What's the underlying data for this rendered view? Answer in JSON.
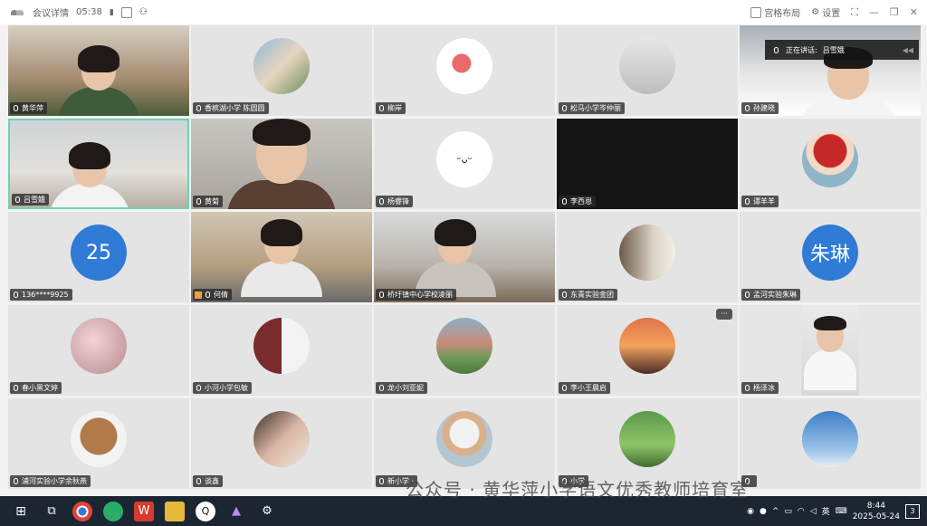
{
  "topbar": {
    "app_title": "会议详情",
    "timer": "05:38",
    "layout_label": "宫格布局",
    "settings_label": "设置"
  },
  "speaker": {
    "label": "正在讲话:",
    "name": "吕雪娥"
  },
  "tiles": [
    {
      "name": "黄华萍",
      "kind": "video"
    },
    {
      "name": "香槟湖小学 陈圆圆",
      "kind": "avatar"
    },
    {
      "name": "柳岸",
      "kind": "avatar"
    },
    {
      "name": "松马小学岑仲丽",
      "kind": "avatar"
    },
    {
      "name": "孙建晓",
      "kind": "video"
    },
    {
      "name": "吕雪娥",
      "kind": "video"
    },
    {
      "name": "黄菊",
      "kind": "video"
    },
    {
      "name": "杨睿锋",
      "kind": "avatar"
    },
    {
      "name": "李西恩",
      "kind": "black"
    },
    {
      "name": "谭羊羊",
      "kind": "avatar"
    },
    {
      "name": "136****9925",
      "kind": "avatar",
      "avatar_text": "25"
    },
    {
      "name": "何倩",
      "kind": "video"
    },
    {
      "name": "桥圩镇中心学校凌丽",
      "kind": "video"
    },
    {
      "name": "东青实验金团",
      "kind": "avatar"
    },
    {
      "name": "孟河实验朱琳",
      "kind": "avatar",
      "avatar_text": "朱琳"
    },
    {
      "name": "春小黑文婷",
      "kind": "avatar"
    },
    {
      "name": "小河小学包敏",
      "kind": "avatar"
    },
    {
      "name": "龙小刘亚妮",
      "kind": "avatar"
    },
    {
      "name": "李小王晨启",
      "kind": "avatar"
    },
    {
      "name": "杨泽冰",
      "kind": "video"
    },
    {
      "name": "浦河实验小学余秋燕",
      "kind": "avatar"
    },
    {
      "name": "谈鑫",
      "kind": "avatar"
    },
    {
      "name": "新小学 ·",
      "kind": "avatar"
    },
    {
      "name": "小学",
      "kind": "avatar"
    },
    {
      "name": "",
      "kind": "avatar"
    }
  ],
  "watermark": "公众号 · 黄华萍小学语文优秀教师培育室",
  "tile_menu": "···",
  "taskbar": {
    "ime": "英",
    "time": "8:44",
    "date": "2025-05-24",
    "notifications": "3"
  },
  "colors": {
    "accent_blue": "#2f7bd6",
    "active_border": "#6fd2b3",
    "taskbar": "#1c2633"
  }
}
